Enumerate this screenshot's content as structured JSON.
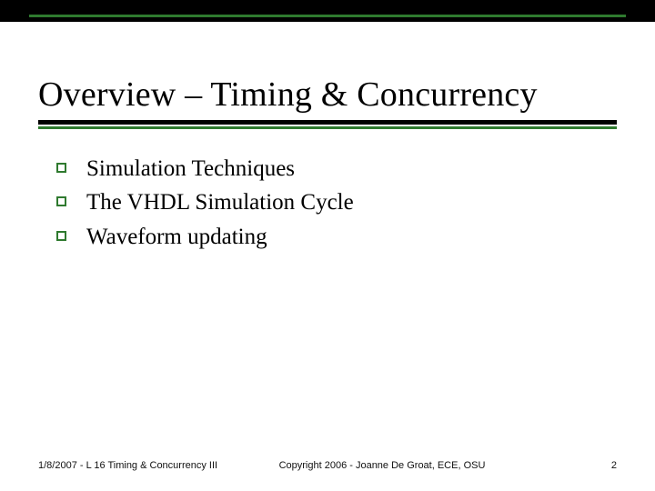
{
  "title": "Overview – Timing & Concurrency",
  "bullets": [
    "Simulation Techniques",
    "The VHDL Simulation Cycle",
    "Waveform updating"
  ],
  "footer": {
    "left": "1/8/2007 - L 16 Timing & Concurrency III",
    "center": "Copyright 2006 - Joanne De Groat, ECE, OSU",
    "right": "2"
  },
  "colors": {
    "accent": "#2f7a2f"
  }
}
